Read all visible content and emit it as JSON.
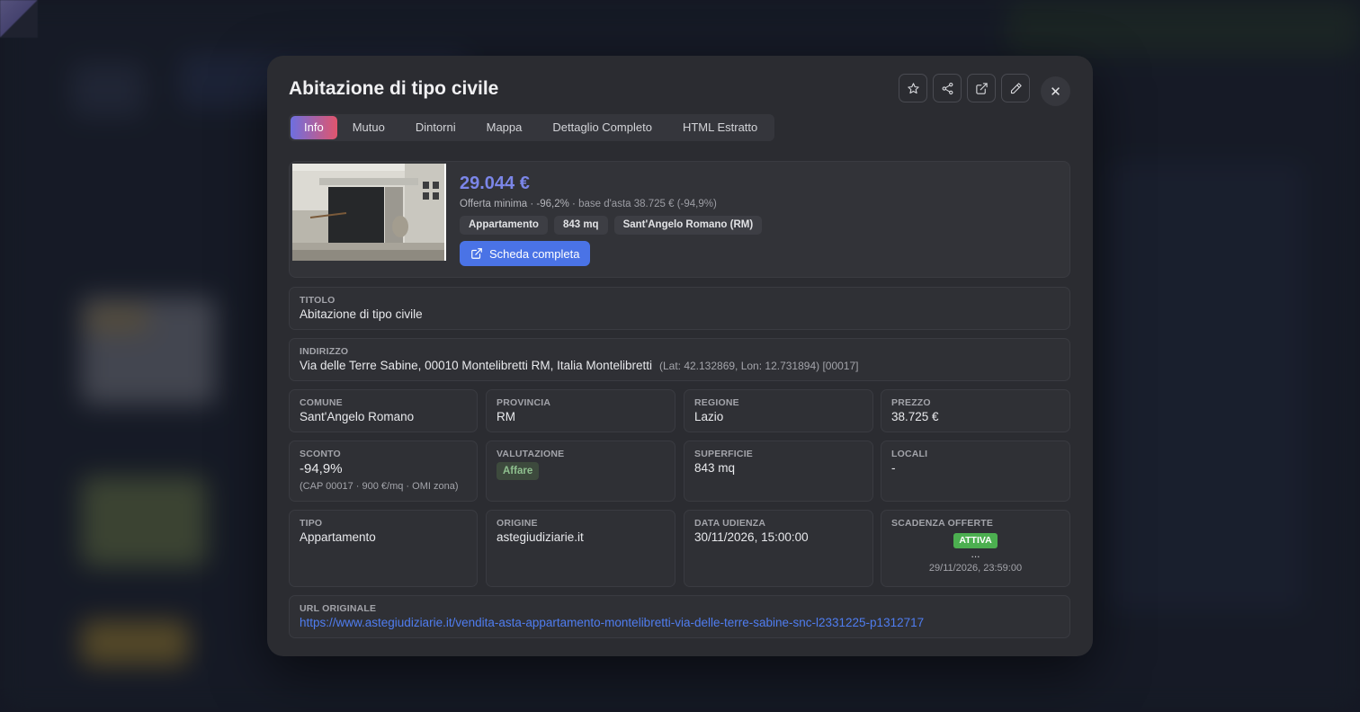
{
  "modal": {
    "title": "Abitazione di tipo civile",
    "close_label": "✕",
    "toolbar": [
      {
        "name": "star-button",
        "icon": "star-icon"
      },
      {
        "name": "share-button",
        "icon": "share-icon"
      },
      {
        "name": "open-external-button",
        "icon": "external-link-icon"
      },
      {
        "name": "edit-button",
        "icon": "pencil-icon"
      }
    ]
  },
  "tabs": [
    "Info",
    "Mutuo",
    "Dintorni",
    "Mappa",
    "Dettaglio Completo",
    "HTML Estratto"
  ],
  "active_tab": "Info",
  "hero": {
    "price": "29.044 €",
    "offer_text": "Offerta minima · -96,2% · ",
    "base_text": "base d'asta 38.725 € (-94,9%)",
    "chips": [
      "Appartamento",
      "843 mq",
      "Sant'Angelo Romano (RM)"
    ],
    "cta_label": "Scheda completa"
  },
  "fields": {
    "titolo": {
      "label": "TITOLO",
      "value": "Abitazione di tipo civile"
    },
    "indirizzo": {
      "label": "INDIRIZZO",
      "value": "Via delle Terre Sabine, 00010 Montelibretti RM, Italia Montelibretti",
      "coords": "(Lat: 42.132869, Lon: 12.731894) [00017]"
    },
    "comune": {
      "label": "COMUNE",
      "value": "Sant'Angelo Romano"
    },
    "provincia": {
      "label": "PROVINCIA",
      "value": "RM"
    },
    "regione": {
      "label": "REGIONE",
      "value": "Lazio"
    },
    "prezzo": {
      "label": "PREZZO",
      "value": "38.725 €"
    },
    "sconto": {
      "label": "SCONTO",
      "value": "-94,9%",
      "note": "(CAP 00017 · 900 €/mq · OMI zona)"
    },
    "valutazione": {
      "label": "VALUTAZIONE",
      "value": "Affare"
    },
    "superficie": {
      "label": "SUPERFICIE",
      "value": "843 mq"
    },
    "locali": {
      "label": "LOCALI",
      "value": "-"
    },
    "tipo": {
      "label": "TIPO",
      "value": "Appartamento"
    },
    "origine": {
      "label": "ORIGINE",
      "value": "astegiudiziarie.it"
    },
    "data_udienza": {
      "label": "DATA UDIENZA",
      "value": "30/11/2026, 15:00:00"
    },
    "scadenza": {
      "label": "SCADENZA OFFERTE",
      "badge": "ATTIVA",
      "dots": "...",
      "value": "29/11/2026, 23:59:00"
    },
    "url": {
      "label": "URL ORIGINALE",
      "value": "https://www.astegiudiziarie.it/vendita-asta-appartamento-montelibretti-via-delle-terre-sabine-snc-l2331225-p1312717"
    }
  },
  "colors": {
    "accent": "#7b86e8",
    "cta": "#4a73e6",
    "link": "#4f7df0",
    "badge_active": "#4caf50"
  }
}
